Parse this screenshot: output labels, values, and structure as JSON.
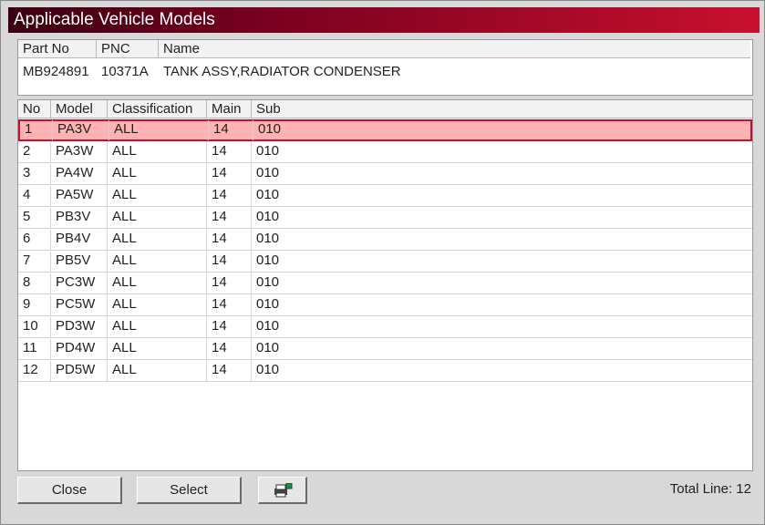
{
  "window": {
    "title": "Applicable Vehicle Models"
  },
  "part": {
    "headers": [
      "Part No",
      "PNC",
      "Name"
    ],
    "values": [
      "MB924891",
      "10371A",
      "TANK ASSY,RADIATOR CONDENSER"
    ]
  },
  "table": {
    "headers": [
      "No",
      "Model",
      "Classification",
      "Main",
      "Sub"
    ],
    "rows": [
      [
        "1",
        "PA3V",
        "ALL",
        "14",
        "010"
      ],
      [
        "2",
        "PA3W",
        "ALL",
        "14",
        "010"
      ],
      [
        "3",
        "PA4W",
        "ALL",
        "14",
        "010"
      ],
      [
        "4",
        "PA5W",
        "ALL",
        "14",
        "010"
      ],
      [
        "5",
        "PB3V",
        "ALL",
        "14",
        "010"
      ],
      [
        "6",
        "PB4V",
        "ALL",
        "14",
        "010"
      ],
      [
        "7",
        "PB5V",
        "ALL",
        "14",
        "010"
      ],
      [
        "8",
        "PC3W",
        "ALL",
        "14",
        "010"
      ],
      [
        "9",
        "PC5W",
        "ALL",
        "14",
        "010"
      ],
      [
        "10",
        "PD3W",
        "ALL",
        "14",
        "010"
      ],
      [
        "11",
        "PD4W",
        "ALL",
        "14",
        "010"
      ],
      [
        "12",
        "PD5W",
        "ALL",
        "14",
        "010"
      ]
    ],
    "selected_row": 1
  },
  "buttons": {
    "close": "Close",
    "select": "Select",
    "print_icon": "printer-icon"
  },
  "status": {
    "total_line": "Total Line: 12"
  },
  "colors": {
    "title_bar_start": "#3a0010",
    "title_bar_end": "#c8102e",
    "selected_row": "#ffb3b3"
  }
}
